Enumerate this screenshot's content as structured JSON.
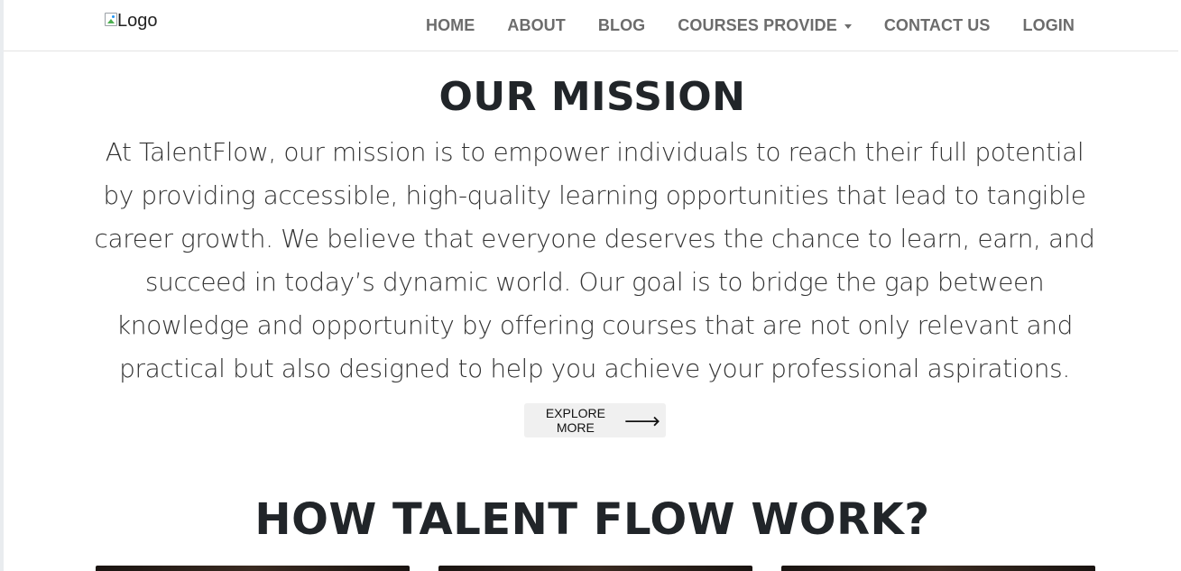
{
  "navbar": {
    "logo_alt": "Logo",
    "links": {
      "home": "HOME",
      "about": "ABOUT",
      "blog": "BLOG",
      "courses": "COURSES PROVIDE",
      "contact": "CONTACT US",
      "login": "LOGIN"
    }
  },
  "mission": {
    "title": "OUR MISSION",
    "text": "At TalentFlow, our mission is to empower individuals to reach their full potential by providing accessible, high-quality learning opportunities that lead to tangible career growth. We believe that everyone deserves the chance to learn, earn, and succeed in today’s dynamic world. Our goal is to bridge the gap between knowledge and opportunity by offering courses that are not only relevant and practical but also designed to help you achieve your professional aspirations.",
    "button_label": "EXPLORE MORE",
    "button_icon": "arrow-right-icon"
  },
  "how": {
    "title": "HOW TALENT FLOW WORK?"
  }
}
